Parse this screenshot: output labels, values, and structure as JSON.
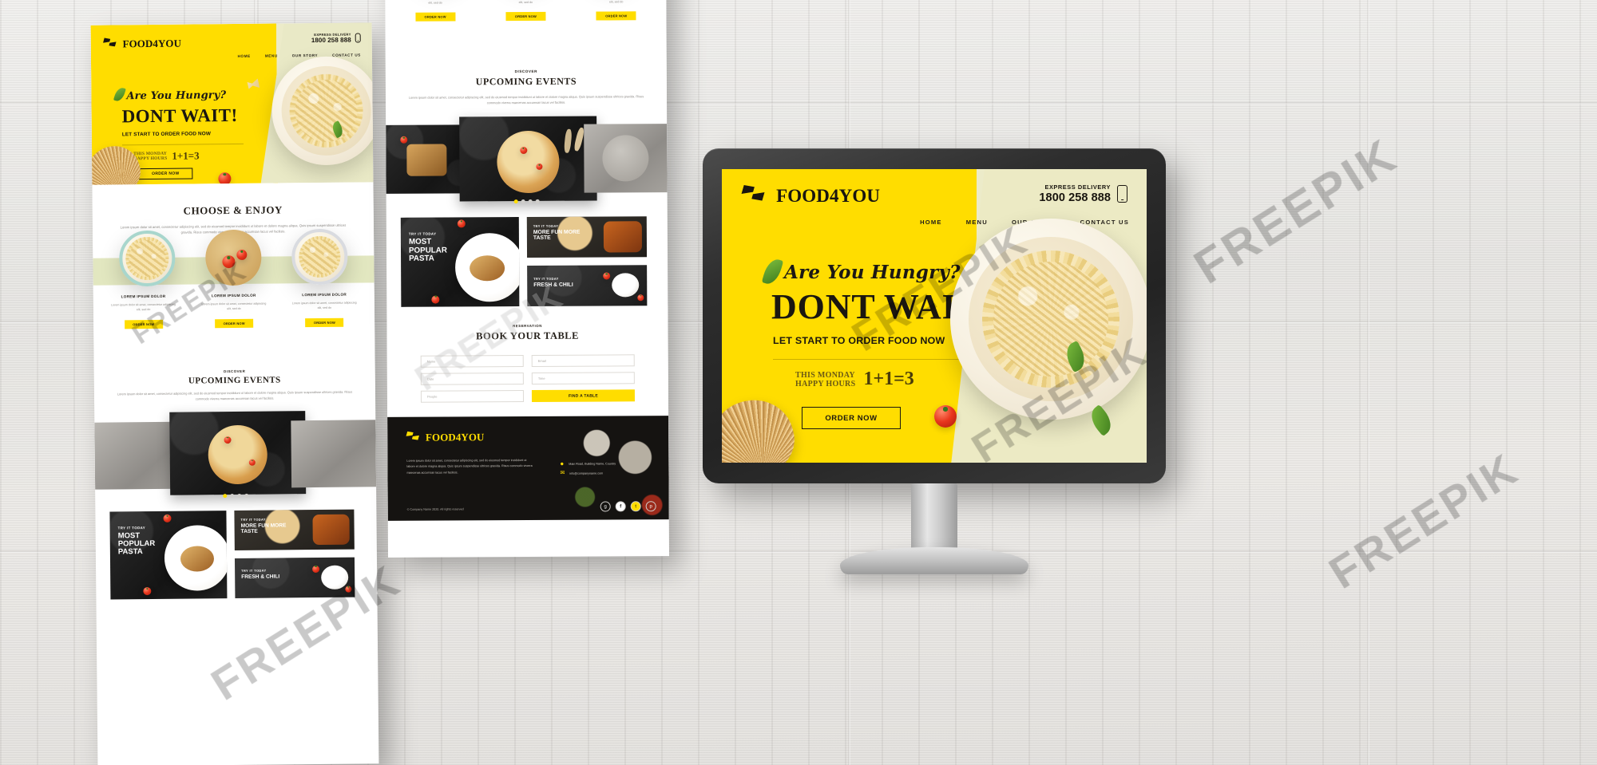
{
  "brand": {
    "name": "FOOD4YOU",
    "colors": {
      "yellow": "#ffdd00",
      "cream": "#ece9c5",
      "dark": "#151311",
      "sage": "#e2e7c0"
    }
  },
  "header": {
    "express_label": "EXPRESS DELIVERY",
    "phone": "1800 258 888",
    "phone_icon": "mobile-phone-icon",
    "nav": [
      {
        "label": "HOME"
      },
      {
        "label": "MENU"
      },
      {
        "label": "OUR STORY"
      },
      {
        "label": "CONTACT US"
      }
    ]
  },
  "hero": {
    "script_line": "Are You Hungry?",
    "headline": "DONT WAIT!",
    "subline": "LET START TO ORDER FOOD NOW",
    "promo_line1": "THIS MONDAY",
    "promo_line2": "HAPPY HOURS",
    "promo_equation": "1+1=3",
    "cta": "ORDER NOW"
  },
  "choose": {
    "title": "CHOOSE & ENJOY",
    "paragraph": "Lorem ipsum dolor sit amet, consectetur adipiscing elit, sed do eiusmod tempor incididunt ut labore et dolore magna aliqua. Quis ipsum suspendisse ultrices gravida. Risus commodo viverra maecenas accumsan lacus vel facilisis.",
    "cards": [
      {
        "title": "LOREM IPSUM DOLOR",
        "text": "Lorem ipsum dolor sit amet, consectetur adipiscing elit, sed do",
        "cta": "ORDER NOW"
      },
      {
        "title": "LOREM IPSUM DOLOR",
        "text": "Lorem ipsum dolor sit amet, consectetur adipiscing elit, sed do",
        "cta": "ORDER NOW"
      },
      {
        "title": "LOREM IPSUM DOLOR",
        "text": "Lorem ipsum dolor sit amet, consectetur adipiscing elit, sed do",
        "cta": "ORDER NOW"
      }
    ]
  },
  "events": {
    "kicker": "DISCOVER",
    "title": "UPCOMING EVENTS",
    "paragraph": "Lorem ipsum dolor sit amet, consectetur adipiscing elit, sed do eiusmod tempor incididunt ut labore et dolore magna aliqua. Quis ipsum suspendisse ultrices gravida. Risus commodo viverra maecenas accumsan lacus vel facilisis.",
    "carousel_dots": 4,
    "carousel_active": 0
  },
  "promo_tiles": {
    "big": {
      "kicker": "TRY IT TODAY",
      "title": "MOST POPULAR PASTA"
    },
    "small_top": {
      "kicker": "TRY IT TODAY",
      "title": "MORE FUN MORE TASTE"
    },
    "small_bottom": {
      "kicker": "TRY IT TODAY",
      "title": "FRESH & CHILI"
    }
  },
  "reservation": {
    "kicker": "RESERVATION",
    "title": "BOOK YOUR TABLE",
    "fields": [
      {
        "name": "name-field",
        "placeholder": "Name"
      },
      {
        "name": "email-field",
        "placeholder": "Email"
      },
      {
        "name": "date-field",
        "placeholder": "Date"
      },
      {
        "name": "time-field",
        "placeholder": "Time"
      },
      {
        "name": "people-field",
        "placeholder": "People"
      }
    ],
    "submit": "FIND A TABLE"
  },
  "footer": {
    "brand": "FOOD4YOU",
    "about": "Lorem ipsum dolor sit amet, consectetur adipiscing elit, sed do eiusmod tempor incididunt ut labore et dolore magna aliqua. Quis ipsum suspendisse ultrices gravida. Risus commodo viverra maecenas accumsan lacus vel facilisis.",
    "address": "Main Road, Building Name, Country",
    "email": "info@companyname.com",
    "copyright": "© Company Name 2020. All rights reserved",
    "social": [
      "g",
      "f",
      "t",
      "p"
    ]
  },
  "watermarks": {
    "text": "FREEPIK"
  }
}
